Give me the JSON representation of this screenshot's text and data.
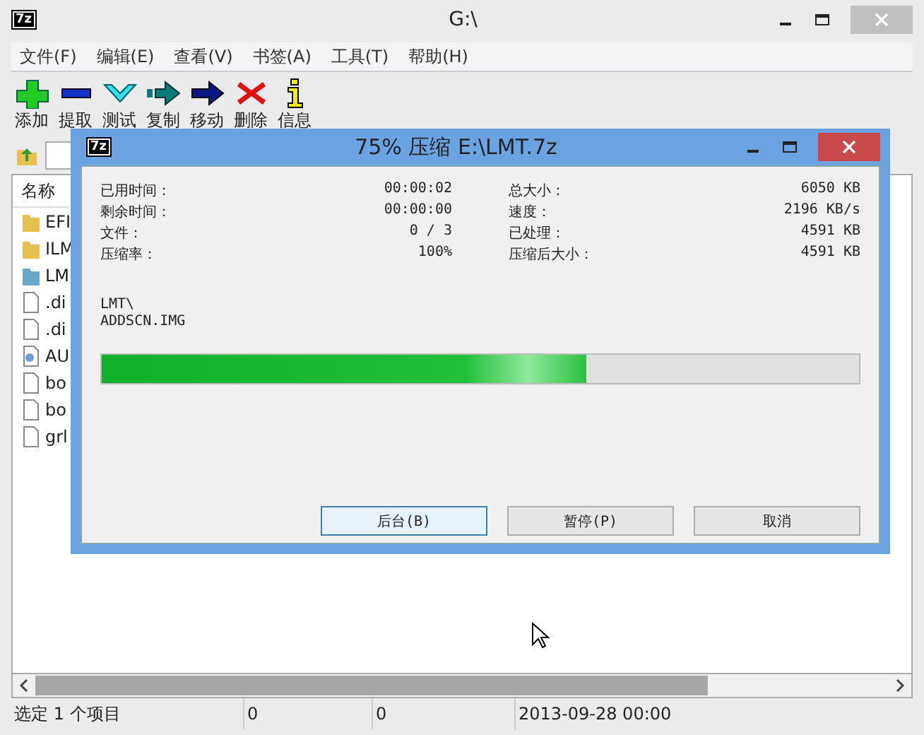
{
  "window": {
    "title": "G:\\",
    "logo": "7z"
  },
  "menu": [
    "文件(F)",
    "编辑(E)",
    "查看(V)",
    "书签(A)",
    "工具(T)",
    "帮助(H)"
  ],
  "toolbar": [
    {
      "kind": "add",
      "label": "添加"
    },
    {
      "kind": "extract",
      "label": "提取"
    },
    {
      "kind": "test",
      "label": "测试"
    },
    {
      "kind": "copy",
      "label": "复制"
    },
    {
      "kind": "move",
      "label": "移动"
    },
    {
      "kind": "delete",
      "label": "删除"
    },
    {
      "kind": "info",
      "label": "信息"
    }
  ],
  "list": {
    "header": "名称",
    "rows": [
      {
        "kind": "folder",
        "name": "EFI"
      },
      {
        "kind": "folder",
        "name": "ILM"
      },
      {
        "kind": "archive",
        "name": "LM"
      },
      {
        "kind": "file",
        "name": ".di"
      },
      {
        "kind": "file",
        "name": ".di"
      },
      {
        "kind": "config",
        "name": "AU"
      },
      {
        "kind": "file",
        "name": "bo"
      },
      {
        "kind": "file",
        "name": "bo"
      },
      {
        "kind": "file",
        "name": "grl"
      }
    ]
  },
  "status_bar": [
    "选定 1 个项目",
    "0",
    "0",
    "2013-09-28 00:00"
  ],
  "dialog": {
    "logo": "7z",
    "title": "75% 压缩 E:\\LMT.7z",
    "stats_left": [
      {
        "label": "已用时间：",
        "value": "00:00:02"
      },
      {
        "label": "剩余时间：",
        "value": "00:00:00"
      },
      {
        "label": "文件：",
        "value": "0 / 3"
      },
      {
        "label": "压缩率：",
        "value": "100%"
      }
    ],
    "stats_right": [
      {
        "label": "总大小：",
        "value": "6050 KB"
      },
      {
        "label": "速度：",
        "value": "2196 KB/s"
      },
      {
        "label": "已处理：",
        "value": "4591 KB"
      },
      {
        "label": "压缩后大小：",
        "value": "4591 KB"
      }
    ],
    "path": "LMT\\",
    "file": "ADDSCN.IMG",
    "progress": {
      "level": 0.64
    },
    "buttons": [
      {
        "label": "后台(B)",
        "selected": true
      },
      {
        "label": "暂停(P)",
        "selected": false
      },
      {
        "label": "取消",
        "selected": false
      }
    ]
  }
}
